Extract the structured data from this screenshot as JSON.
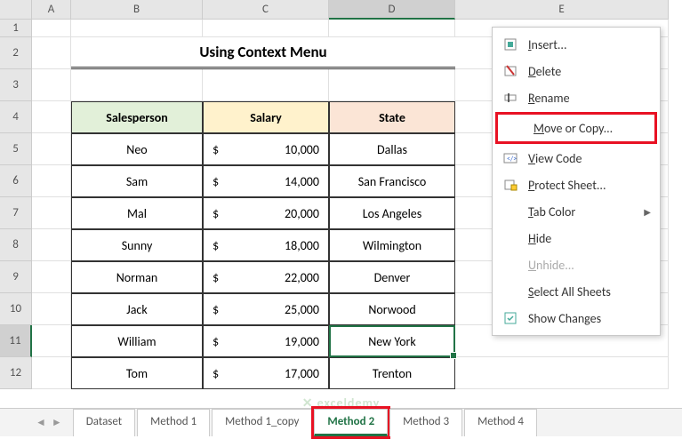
{
  "columns": [
    "",
    "A",
    "B",
    "C",
    "D",
    "E"
  ],
  "rows": [
    "1",
    "2",
    "3",
    "4",
    "5",
    "6",
    "7",
    "8",
    "9",
    "10",
    "11",
    "12"
  ],
  "title": "Using Context Menu",
  "headers": {
    "salesperson": "Salesperson",
    "salary": "Salary",
    "state": "State"
  },
  "currency": "$",
  "data": [
    {
      "name": "Neo",
      "salary": "10,000",
      "state": "Dallas"
    },
    {
      "name": "Sam",
      "salary": "14,000",
      "state": "San Francisco"
    },
    {
      "name": "Mal",
      "salary": "20,000",
      "state": "Los Angeles"
    },
    {
      "name": "Sunny",
      "salary": "18,000",
      "state": "Wilmington"
    },
    {
      "name": "Norman",
      "salary": "22,000",
      "state": "Denver"
    },
    {
      "name": "Jack",
      "salary": "25,000",
      "state": "Norwood"
    },
    {
      "name": "William",
      "salary": "19,000",
      "state": "New York"
    },
    {
      "name": "Tom",
      "salary": "17,000",
      "state": "Trenton"
    }
  ],
  "menu": {
    "insert": "Insert...",
    "delete": "Delete",
    "rename": "Rename",
    "move_copy": "Move or Copy...",
    "view_code": "View Code",
    "protect": "Protect Sheet...",
    "tab_color": "Tab Color",
    "hide": "Hide",
    "unhide": "Unhide...",
    "select_all": "Select All Sheets",
    "show_changes": "Show Changes"
  },
  "tabs": [
    "Dataset",
    "Method 1",
    "Method 1_copy",
    "Method 2",
    "Method 3",
    "Method 4"
  ],
  "watermark": "exceldemy"
}
